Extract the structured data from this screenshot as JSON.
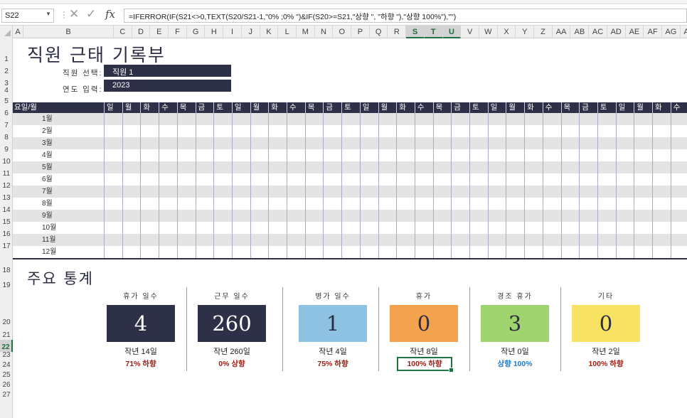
{
  "namebox": "S22",
  "formula": "=IFERROR(IF(S21<>0,TEXT(S20/S21-1,\"0% ;0% \")&IF(S20>=S21,\"상향 \", \"하향 \"),\"상향 100%\"),\"\")",
  "columns": [
    "A",
    "B",
    "C",
    "D",
    "E",
    "F",
    "G",
    "H",
    "I",
    "J",
    "K",
    "L",
    "M",
    "N",
    "O",
    "P",
    "Q",
    "R",
    "S",
    "T",
    "U",
    "V",
    "W",
    "X",
    "Y",
    "Z",
    "AA",
    "AB",
    "AC",
    "AD",
    "AE",
    "AF",
    "AG",
    "AH"
  ],
  "selected_columns": [
    "S",
    "T",
    "U"
  ],
  "rows": [
    "1",
    "2",
    "3",
    "4",
    "5",
    "6",
    "7",
    "8",
    "9",
    "10",
    "11",
    "12",
    "13",
    "14",
    "15",
    "16",
    "17",
    "18",
    "19",
    "20",
    "21",
    "22",
    "23",
    "24",
    "25",
    "26",
    "27"
  ],
  "selected_row": "22",
  "sheet": {
    "title": "직원 근태 기록부",
    "employee_label": "직원 선택:",
    "employee_value": "직원 1",
    "year_label": "연도 입력:",
    "year_value": "2023"
  },
  "calendar": {
    "header_label": "요일/월",
    "weekdays": [
      "일",
      "월",
      "화",
      "수",
      "목",
      "금",
      "토",
      "일",
      "월",
      "화",
      "수",
      "목",
      "금",
      "토",
      "일",
      "월",
      "화",
      "수",
      "목",
      "금",
      "토",
      "일",
      "월",
      "화",
      "수",
      "목",
      "금",
      "토",
      "일",
      "월",
      "화",
      "수"
    ],
    "months": [
      "1월",
      "2월",
      "3월",
      "4월",
      "5월",
      "6월",
      "7월",
      "8월",
      "9월",
      "10월",
      "11월",
      "12월"
    ]
  },
  "stats": {
    "title": "주요 통계",
    "items": [
      {
        "label": "휴가 일수",
        "value": "4",
        "prev": "작년 14일",
        "change": "71% 하향",
        "bg": "#2e3047",
        "fg": "#ffffff",
        "change_color": "#a01e16"
      },
      {
        "label": "근무 일수",
        "value": "260",
        "prev": "작년 260일",
        "change": "0% 상향",
        "bg": "#2e3047",
        "fg": "#ffffff",
        "change_color": "#a01e16"
      },
      {
        "label": "병가 일수",
        "value": "1",
        "prev": "작년 4일",
        "change": "75% 하향",
        "bg": "#8ec2e2",
        "fg": "#2b2d42",
        "change_color": "#a01e16"
      },
      {
        "label": "휴가",
        "value": "0",
        "prev": "작년 8일",
        "change": "100% 하향",
        "bg": "#f5a24e",
        "fg": "#2b2d42",
        "change_color": "#a01e16"
      },
      {
        "label": "경조 휴가",
        "value": "3",
        "prev": "작년 0일",
        "change": "상향 100%",
        "bg": "#9fd36e",
        "fg": "#2b2d42",
        "change_color": "#1f7ac4"
      },
      {
        "label": "기타",
        "value": "0",
        "prev": "작년 2일",
        "change": "100% 하향",
        "bg": "#f7e264",
        "fg": "#2b2d42",
        "change_color": "#a01e16"
      }
    ]
  }
}
